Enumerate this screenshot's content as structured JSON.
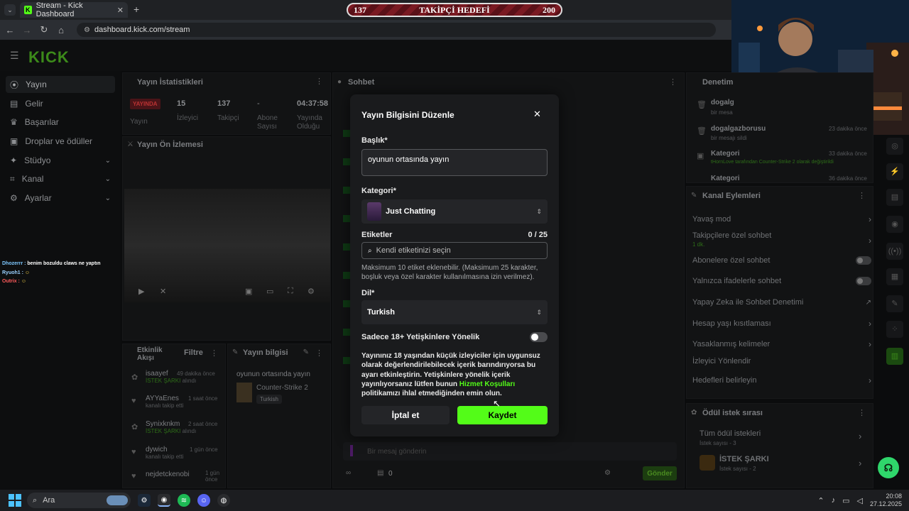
{
  "browser": {
    "tab_title": "Stream - Kick Dashboard",
    "url": "dashboard.kick.com/stream"
  },
  "goal": {
    "current": "137",
    "label": "TAKİPÇİ HEDEFİ",
    "target": "200"
  },
  "app": {
    "logo": "KICK"
  },
  "sidebar": {
    "items": [
      {
        "label": "Yayın"
      },
      {
        "label": "Gelir"
      },
      {
        "label": "Başarılar"
      },
      {
        "label": "Droplar ve ödüller"
      },
      {
        "label": "Stüdyo"
      },
      {
        "label": "Kanal"
      },
      {
        "label": "Ayarlar"
      }
    ]
  },
  "overlay_chat": [
    {
      "user": "Dhozerrr :",
      "msg": "benim",
      "msg2": "bozuldu claws ne yaptın"
    },
    {
      "user": "Ryuoh1 :",
      "msg": ""
    },
    {
      "user": "Outrix :",
      "msg": ""
    }
  ],
  "stats": {
    "title": "Yayın İstatistikleri",
    "live_badge": "YAYINDA",
    "live_label": "Yayın",
    "viewers_value": "15",
    "viewers_label": "İzleyici",
    "followers_value": "137",
    "followers_label": "Takipçi",
    "subs_value": "-",
    "subs_label1": "Abone",
    "subs_label2": "Sayısı",
    "uptime_value": "04:37:58",
    "uptime_label1": "Yayında",
    "uptime_label2": "Olduğu"
  },
  "preview": {
    "title": "Yayın Ön İzlemesi"
  },
  "activity": {
    "title1": "Etkinlik",
    "title2": "Akışı",
    "filter": "Filtre",
    "items": [
      {
        "name": "isaayef",
        "time": "49 dakika önce",
        "desc": "İSTEK ŞARKI",
        "desc2": "alındı"
      },
      {
        "name": "AYYaEnes",
        "time": "1 saat önce",
        "desc": "kanalı takip etti",
        "desc2": ""
      },
      {
        "name": "Synixknkm",
        "time": "2 saat önce",
        "desc": "İSTEK ŞARKI",
        "desc2": "alındı"
      },
      {
        "name": "dywich",
        "time": "1 gün önce",
        "desc": "kanalı takip etti",
        "desc2": ""
      },
      {
        "name": "nejdetckenobi",
        "time": "1 gün",
        "desc": "önce",
        "desc2": ""
      }
    ]
  },
  "stream_info": {
    "title": "Yayın bilgisi",
    "stream_title": "oyunun ortasında yayın",
    "category": "Counter-Strike 2",
    "tag": "Turkish"
  },
  "chat": {
    "title": "Sohbet",
    "placeholder": "Bir mesaj gönderin",
    "count1": "0",
    "send": "Gönder"
  },
  "moderation": {
    "title": "Denetim",
    "entries": [
      {
        "name": "dogalg",
        "desc": "bir mesa",
        "time": ""
      },
      {
        "name": "dogalgazborusu",
        "desc": "bir mesajı sildi",
        "time": "23 dakika önce"
      },
      {
        "name": "Kategori",
        "desc": "tHornLove tarafından Counter-Strike 2 olarak değiştirildi",
        "time": "33 dakika önce"
      },
      {
        "name": "Kategori",
        "desc": "",
        "time": "36 dakika önce"
      }
    ]
  },
  "channel_actions": {
    "title": "Kanal Eylemleri",
    "rows": [
      {
        "label": "Yavaş mod",
        "sub": ""
      },
      {
        "label": "Takipçilere özel sohbet",
        "sub": "1 dk."
      },
      {
        "label": "Abonelere özel sohbet",
        "sub": ""
      },
      {
        "label": "Yalnızca ifadelerle sohbet",
        "sub": ""
      },
      {
        "label": "Yapay Zeka ile Sohbet Denetimi",
        "sub": ""
      },
      {
        "label": "Hesap yaşı kısıtlaması",
        "sub": ""
      },
      {
        "label": "Yasaklanmış kelimeler",
        "sub": ""
      },
      {
        "label": "İzleyici Yönlendir",
        "sub": ""
      },
      {
        "label": "Hedefleri belirleyin",
        "sub": ""
      }
    ]
  },
  "rewards": {
    "title": "Ödül istek sırası",
    "all_label": "Tüm ödül istekleri",
    "all_sub": "İstek sayısı - 3",
    "song_label": "İSTEK ŞARKI",
    "song_sub": "İstek sayısı - 2"
  },
  "modal": {
    "title": "Yayın Bilgisini Düzenle",
    "title_label": "Başlık*",
    "title_value": "oyunun ortasında yayın",
    "category_label": "Kategori*",
    "category_value": "Just Chatting",
    "tags_label": "Etiketler",
    "tags_count": "0 / 25",
    "tags_placeholder": "Kendi etiketinizi seçin",
    "tags_help": "Maksimum 10 etiket eklenebilir. (Maksimum 25 karakter, boşluk veya özel karakter kullanılmasına izin verilmez).",
    "lang_label": "Dil*",
    "lang_value": "Turkish",
    "adult_label": "Sadece 18+ Yetişkinlere Yönelik",
    "adult_text1": "Yayınınız 18 yaşından küçük izleyiciler için uygunsuz olarak değerlendirilebilecek içerik barındırıyorsa bu ayarı etkinleştirin. Yetişkinlere yönelik içerik yayınlıyorsanız lütfen bunun",
    "adult_link": "Hizmet Koşulları",
    "adult_text2": "politikamızı ihlal etmediğinden emin olun.",
    "cancel": "İptal et",
    "save": "Kaydet"
  },
  "taskbar": {
    "search": "Ara",
    "time": "20:08",
    "date": "27.12.2025"
  },
  "colors": {
    "accent": "#53fc18",
    "modal_bg": "#1a1b1d",
    "goal_red": "#7a1a22"
  }
}
